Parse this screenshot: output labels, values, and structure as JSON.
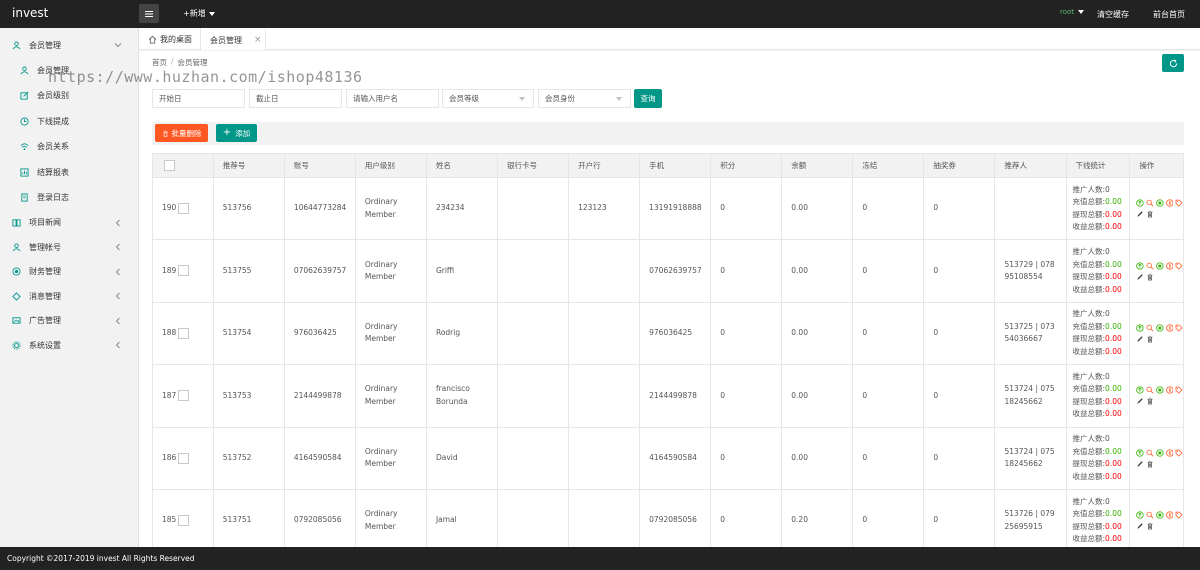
{
  "app": {
    "title": "invest"
  },
  "topbar": {
    "add_new": "+新增",
    "user": "root",
    "clear_cache": "清空缓存",
    "front_home": "前台首页"
  },
  "sidebar": {
    "groups": [
      {
        "label": "会员管理",
        "children": [
          "会员管理",
          "会员级别",
          "下线提成",
          "会员关系",
          "结算报表",
          "登录日志"
        ]
      },
      {
        "label": "项目新闻"
      },
      {
        "label": "管理帐号"
      },
      {
        "label": "财务管理"
      },
      {
        "label": "消息管理"
      },
      {
        "label": "广告管理"
      },
      {
        "label": "系统设置"
      }
    ]
  },
  "tabs": {
    "home": "我的桌面",
    "active": "会员管理"
  },
  "breadcrumb": {
    "home": "首页",
    "sep": "/",
    "current": "会员管理"
  },
  "filters": {
    "start_date": "开始日",
    "end_date": "截止日",
    "username": "请输入用户名",
    "level": "会员等级",
    "identity": "会员身份",
    "query": "查询"
  },
  "toolbar": {
    "batch_delete": "批量删除",
    "add": "添加"
  },
  "table": {
    "headers": [
      "",
      "推荐号",
      "账号",
      "用户级别",
      "姓名",
      "银行卡号",
      "开户行",
      "手机",
      "积分",
      "余额",
      "冻结",
      "抽奖券",
      "推荐人",
      "下线统计",
      "操作"
    ],
    "stat_labels": {
      "promoters": "推广人数:",
      "recharge": "充值总额:",
      "withdraw": "提现总额:",
      "income": "收益总额:"
    },
    "rows": [
      {
        "id": "190",
        "ref": "513756",
        "account": "10644773284",
        "level": "Ordinary Member",
        "name": "234234",
        "bank_card": "",
        "bank": "123123",
        "phone": "13191918888",
        "points": "0",
        "balance": "0.00",
        "frozen": "0",
        "tickets": "0",
        "referrer": "",
        "promoters": "0",
        "recharge": "0.00",
        "withdraw": "0.00",
        "income": "0.00"
      },
      {
        "id": "189",
        "ref": "513755",
        "account": "07062639757",
        "level": "Ordinary Member",
        "name": "Griffi",
        "bank_card": "",
        "bank": "",
        "phone": "07062639757",
        "points": "0",
        "balance": "0.00",
        "frozen": "0",
        "tickets": "0",
        "referrer": "513729 | 07895108554",
        "promoters": "0",
        "recharge": "0.00",
        "withdraw": "0.00",
        "income": "0.00"
      },
      {
        "id": "188",
        "ref": "513754",
        "account": "976036425",
        "level": "Ordinary Member",
        "name": "Rodrig",
        "bank_card": "",
        "bank": "",
        "phone": "976036425",
        "points": "0",
        "balance": "0.00",
        "frozen": "0",
        "tickets": "0",
        "referrer": "513725 | 07354036667",
        "promoters": "0",
        "recharge": "0.00",
        "withdraw": "0.00",
        "income": "0.00"
      },
      {
        "id": "187",
        "ref": "513753",
        "account": "2144499878",
        "level": "Ordinary Member",
        "name": "francisco Borunda",
        "bank_card": "",
        "bank": "",
        "phone": "2144499878",
        "points": "0",
        "balance": "0.00",
        "frozen": "0",
        "tickets": "0",
        "referrer": "513724 | 07518245662",
        "promoters": "0",
        "recharge": "0.00",
        "withdraw": "0.00",
        "income": "0.00"
      },
      {
        "id": "186",
        "ref": "513752",
        "account": "4164590584",
        "level": "Ordinary Member",
        "name": "David",
        "bank_card": "",
        "bank": "",
        "phone": "4164590584",
        "points": "0",
        "balance": "0.00",
        "frozen": "0",
        "tickets": "0",
        "referrer": "513724 | 07518245662",
        "promoters": "0",
        "recharge": "0.00",
        "withdraw": "0.00",
        "income": "0.00"
      },
      {
        "id": "185",
        "ref": "513751",
        "account": "0792085056",
        "level": "Ordinary Member",
        "name": "Jamal",
        "bank_card": "",
        "bank": "",
        "phone": "0792085056",
        "points": "0",
        "balance": "0.20",
        "frozen": "0",
        "tickets": "0",
        "referrer": "513726 | 07925695915",
        "promoters": "0",
        "recharge": "0.00",
        "withdraw": "0.00",
        "income": "0.00"
      }
    ]
  },
  "footer": {
    "copyright": "Copyright ©2017-2019 invest All Rights Reserved"
  },
  "watermark": {
    "text": "https://www.huzhan.com/ishop48136"
  },
  "colors": {
    "topbar": "#222222",
    "primary": "#009688",
    "danger": "#ff5722",
    "green": "#33b300",
    "red": "#ff0000"
  }
}
